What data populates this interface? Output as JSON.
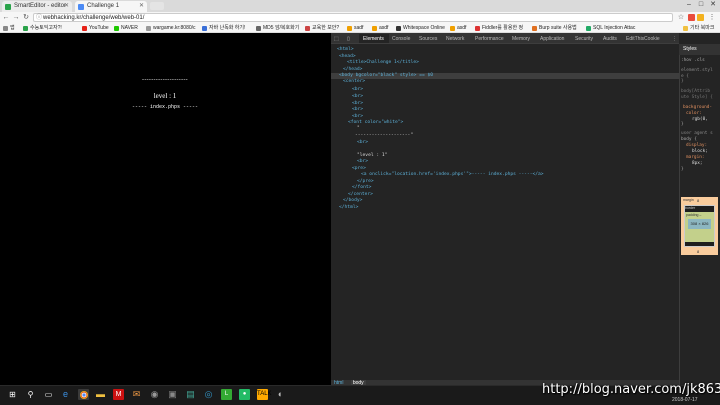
{
  "browser": {
    "tabs": [
      {
        "title": "SmartEditor - editor",
        "active": false
      },
      {
        "title": "Challenge 1",
        "active": true
      }
    ],
    "address": "webhacking.kr/challenge/web/web-01/",
    "bookmarks": [
      "앱",
      "수능토익고자?!",
      "YouTube",
      "NAVER",
      "wargame.kr:8080/c",
      "자바 난독화 하기!",
      "MD5 암/복호화기",
      "교육한 보안?",
      "sadf",
      "asdf",
      "Whitespace Online",
      "asdf",
      "Fiddler를 활용한 정",
      "Burp suite 사용법",
      "SQL Injection Attac",
      "기타 북마크"
    ]
  },
  "page": {
    "dashes": "--------------------",
    "level": "level : 1",
    "link": "----- index.phps -----"
  },
  "devtools": {
    "tabs": [
      "Elements",
      "Console",
      "Sources",
      "Network",
      "Performance",
      "Memory",
      "Application",
      "Security",
      "Audits",
      "EditThisCookie"
    ],
    "active_tab": "Elements",
    "dom": {
      "html_open": "<html>",
      "head_open": "<head>",
      "title_line": "<title>Challenge 1</title>",
      "head_close": "</head>",
      "body_line": "<body bgcolor=\"black\" style> == $0",
      "center_open": "<center>",
      "br": "<br>",
      "font_open": "<font color=\"white\">",
      "quote": "\"",
      "dash_line": "--------------------\"",
      "level_line": "\"level : 1\"",
      "pre_open": "<pre>",
      "anchor_line": "<a onclick=\"location.href='index.phps'\">----- index.phps -----</a>",
      "pre_close": "</pre>",
      "font_close": "</font>",
      "center_close": "</center>",
      "body_close": "</body>",
      "html_close": "</html>"
    },
    "breadcrumbs": [
      "html",
      "body"
    ],
    "styles_tab": "Styles",
    "styles": {
      "filter": ":hov .cls",
      "element_style": "element.styl",
      "element_brace": "e {",
      "element_close": "}",
      "body_selector": "body[Attrib",
      "body_selector2": "ute Style] {",
      "bg_prop": "background-",
      "bg_prop2": "color:",
      "bg_val": "rgb(0,",
      "ua_label": "user agent s",
      "ua_body": "body {",
      "display_prop": "display:",
      "display_val": "block;",
      "margin_prop": "margin:",
      "margin_val": "8px;",
      "close": "}"
    },
    "box_model": {
      "margin_label": "margin",
      "border_label": "border",
      "padding_label": "padding –",
      "content_size": "308 × 826",
      "margin_value": "8"
    }
  },
  "taskbar": {
    "watermark": "http://blog.naver.com/jk8639",
    "clock": "2018-07-17"
  }
}
